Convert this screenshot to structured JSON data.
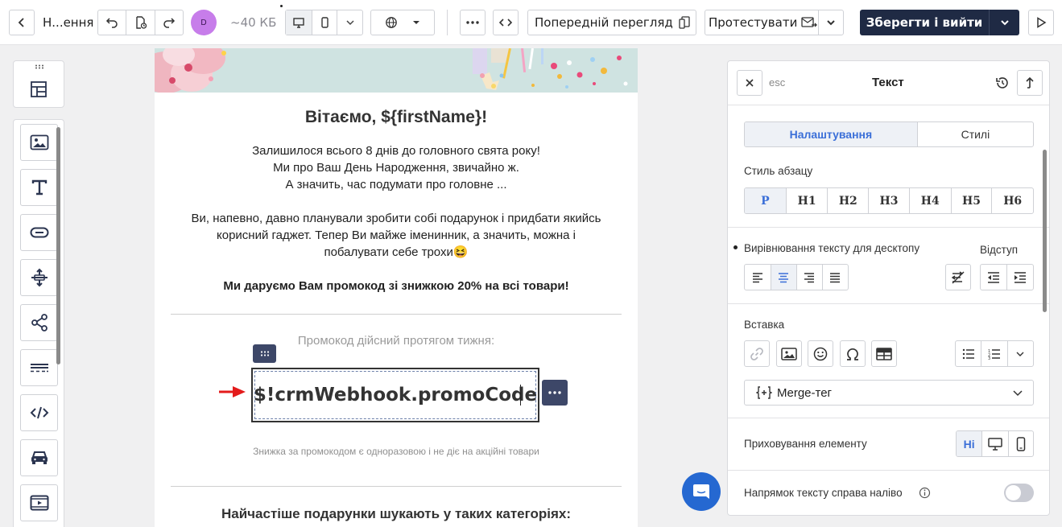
{
  "toolbar": {
    "title": "Н...ення",
    "avatar_initial": "D",
    "size": "~40 КБ",
    "preview_label": "Попередній перегляд",
    "test_label": "Протестувати",
    "save_label": "Зберегти і вийти"
  },
  "email": {
    "greeting": "Вітаємо, ${firstName}!",
    "para1": [
      "Залишилося всього 8 днів до головного свята року!",
      "Ми про Ваш День Народження, звичайно ж.",
      "А значить, час подумати про головне ..."
    ],
    "para2": [
      "Ви, напевно, давно планували зробити собі подарунок і придбати якийсь",
      "корисний гаджет. Тепер Ви майже іменинник, а значить, можна і",
      "побалувати себе трохи😆"
    ],
    "promo_intro": "Ми даруємо Вам промокод зі знижкою 20% на всі товари!",
    "validity": "Промокод дійсний протягом тижня:",
    "promo_code": "$!crmWebhook.promoCode",
    "disclaimer": "Знижка за промокодом є одноразовою і не діє на акційні товари",
    "categories_title": "Найчастіше подарунки шукають у таких категоріях:"
  },
  "panel": {
    "esc_label": "esc",
    "title": "Текст",
    "tabs": [
      "Налаштування",
      "Стилі"
    ],
    "paragraph_style_label": "Стиль абзацу",
    "paragraph_styles": [
      "P",
      "H1",
      "H2",
      "H3",
      "H4",
      "H5",
      "H6"
    ],
    "align_label": "Вирівнювання тексту для десктопу",
    "indent_label": "Відступ",
    "insert_label": "Вставка",
    "merge_tag_label": "Merge-тег",
    "hide_label": "Приховування елементу",
    "hide_none": "Ні",
    "rtl_label": "Напрямок тексту справа наліво"
  },
  "colors": {
    "accent": "#3b6fd8",
    "save_bg": "#1f2a44",
    "handle_bg": "#3d4768",
    "chat_bg": "#2568d1",
    "arrow": "#e31b1b"
  }
}
